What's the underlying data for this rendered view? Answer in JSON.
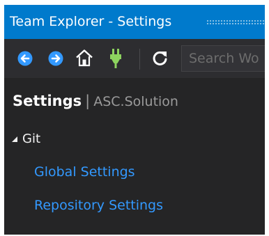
{
  "window": {
    "title": "Team Explorer - Settings"
  },
  "toolbar": {
    "back_icon": "back-arrow-icon",
    "forward_icon": "forward-arrow-icon",
    "home_icon": "home-icon",
    "connect_icon": "plug-icon",
    "refresh_icon": "refresh-icon",
    "search_placeholder": "Search Wo"
  },
  "header": {
    "title": "Settings",
    "separator": "|",
    "context": "ASC.Solution"
  },
  "section": {
    "label": "Git",
    "links": [
      "Global Settings",
      "Repository Settings"
    ]
  },
  "colors": {
    "titlebar": "#007acc",
    "background": "#252526",
    "link": "#3399ff",
    "plug": "#8dd35f"
  }
}
